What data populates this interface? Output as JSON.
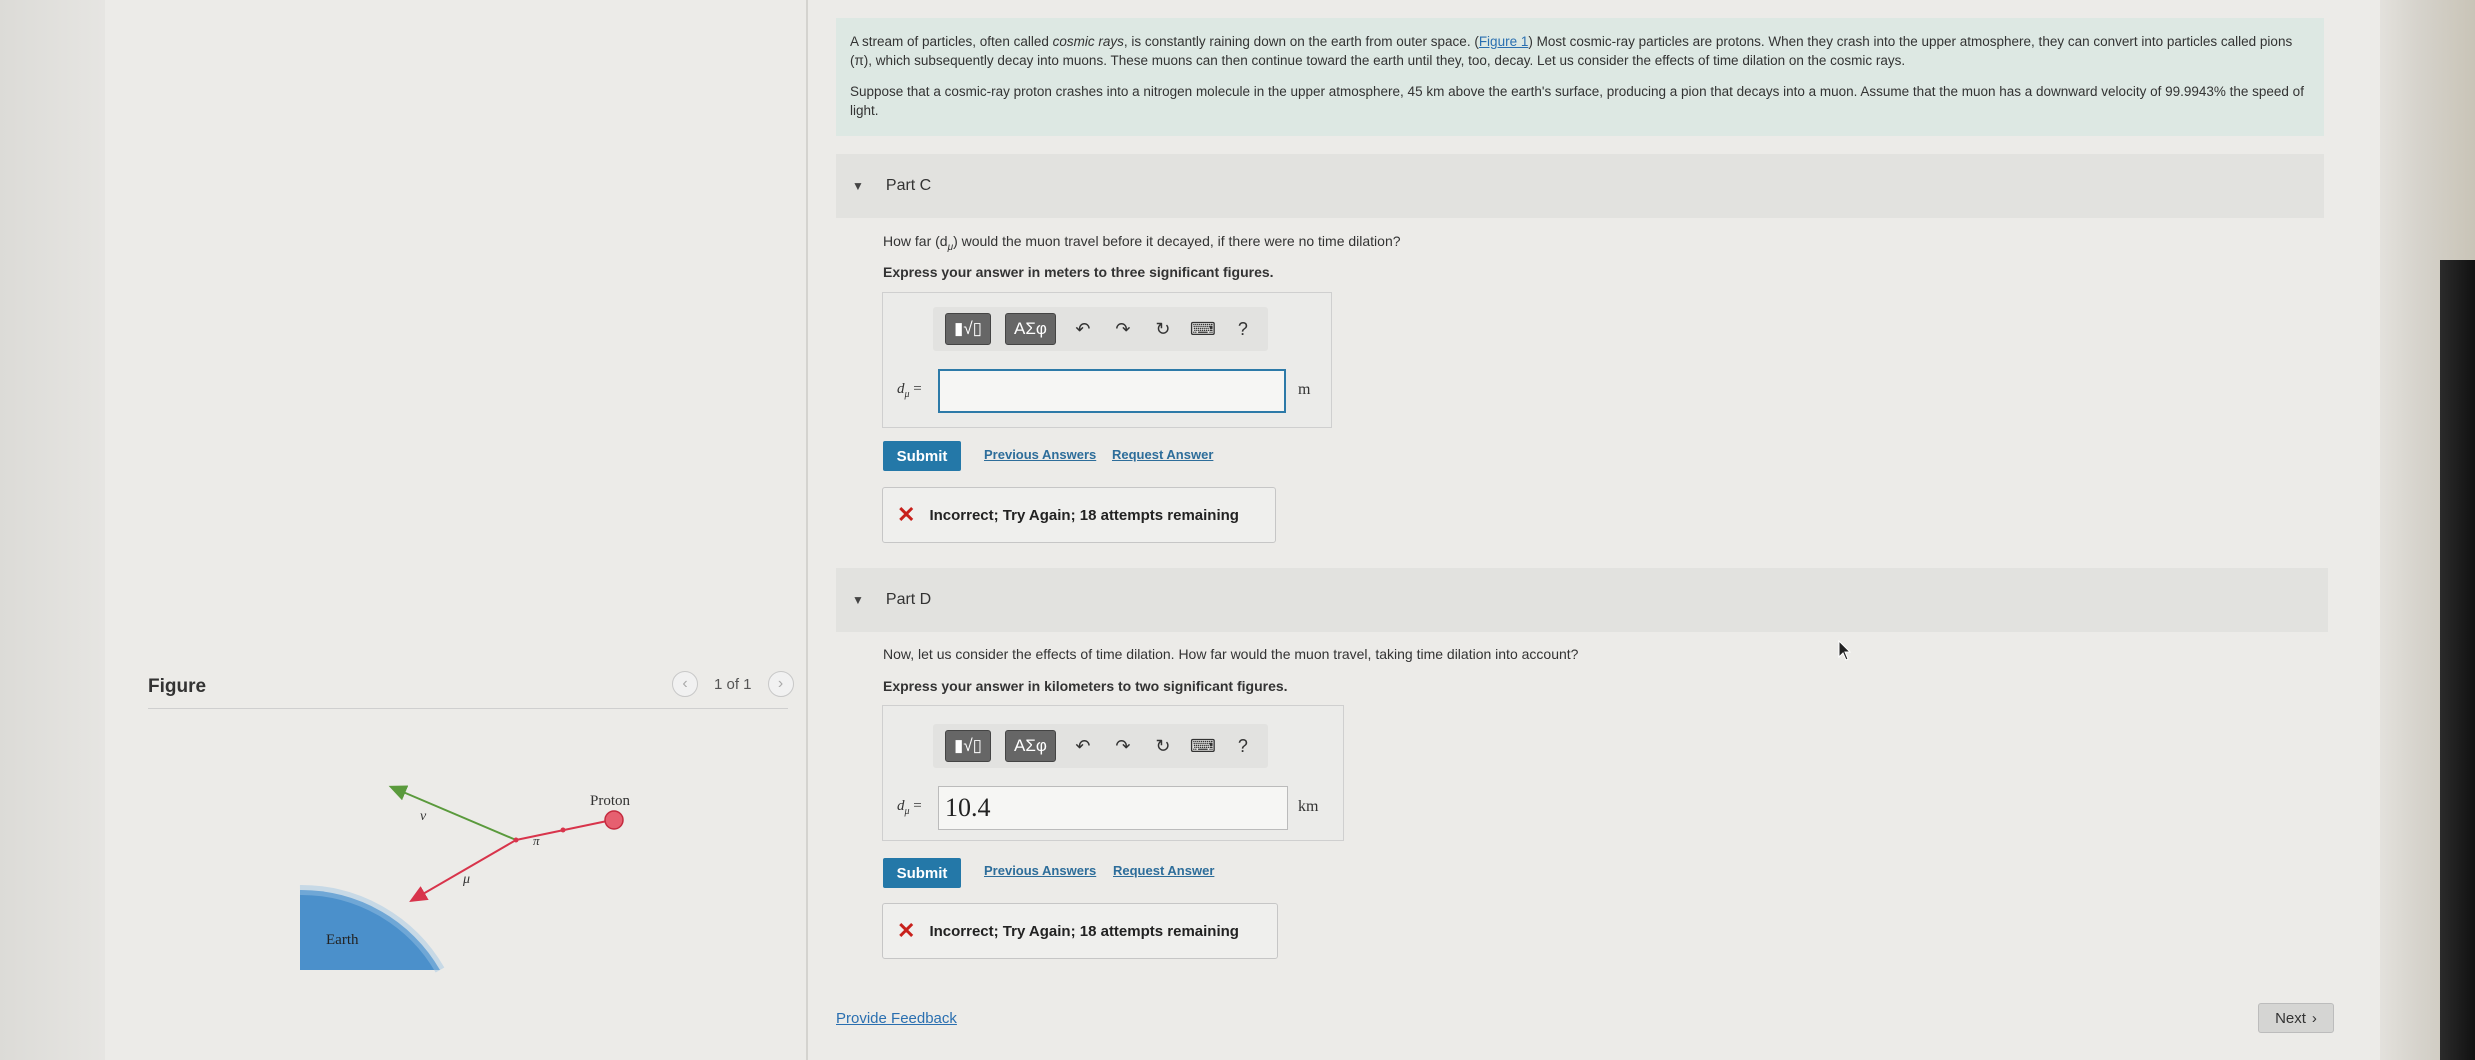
{
  "intro": {
    "p1_a": "A stream of particles, often called ",
    "p1_em": "cosmic rays",
    "p1_b": ", is constantly raining down on the earth from outer space. (",
    "p1_link": "Figure 1",
    "p1_c": ") Most cosmic-ray particles are protons. When they crash into the upper atmosphere, they can convert into particles called pions (π), which subsequently decay into muons. These muons can then continue toward the earth until they, too, decay. Let us consider the effects of time dilation on the cosmic rays.",
    "p2": "Suppose that a cosmic-ray proton crashes into a nitrogen molecule in the upper atmosphere, 45 km above the earth's surface, producing a pion that decays into a muon. Assume that the muon has a downward velocity of 99.9943% the speed of light."
  },
  "partC": {
    "title": "Part C",
    "question_a": "How far (d",
    "question_sub": "μ",
    "question_b": ") would the muon travel before it decayed, if there were no time dilation?",
    "instruction": "Express your answer in meters to three significant figures.",
    "var": "d",
    "var_sub": "μ",
    "equals": "=",
    "value": "",
    "unit": "m",
    "submit": "Submit",
    "previous_answers": "Previous Answers",
    "request_answer": "Request Answer",
    "feedback": "Incorrect; Try Again; 18 attempts remaining"
  },
  "partD": {
    "title": "Part D",
    "question": "Now, let us consider the effects of time dilation. How far would the muon travel, taking time dilation into account?",
    "instruction": "Express your answer in kilometers to two significant figures.",
    "var": "d",
    "var_sub": "μ",
    "equals": "=",
    "value": "10.4",
    "unit": "km",
    "submit": "Submit",
    "previous_answers": "Previous Answers",
    "request_answer": "Request Answer",
    "feedback": "Incorrect; Try Again; 18 attempts remaining"
  },
  "toolbar": {
    "template_btn": "▮√▯",
    "greek_btn": "ΑΣφ",
    "undo_icon": "undo-icon",
    "redo_icon": "redo-icon",
    "reset_icon": "reset-icon",
    "keyboard_icon": "keyboard-icon",
    "help": "?"
  },
  "figure": {
    "title": "Figure",
    "counter": "1 of 1",
    "prev": "‹",
    "next": "›",
    "labels": {
      "proton": "Proton",
      "nu": "ν",
      "pi": "π",
      "mu": "μ",
      "earth": "Earth"
    },
    "colors": {
      "green": "#5a9a3c",
      "red": "#d8344b",
      "earth": "#3a86c8"
    }
  },
  "footer": {
    "provide_feedback": "Provide Feedback",
    "next": "Next",
    "next_icon": "›"
  }
}
